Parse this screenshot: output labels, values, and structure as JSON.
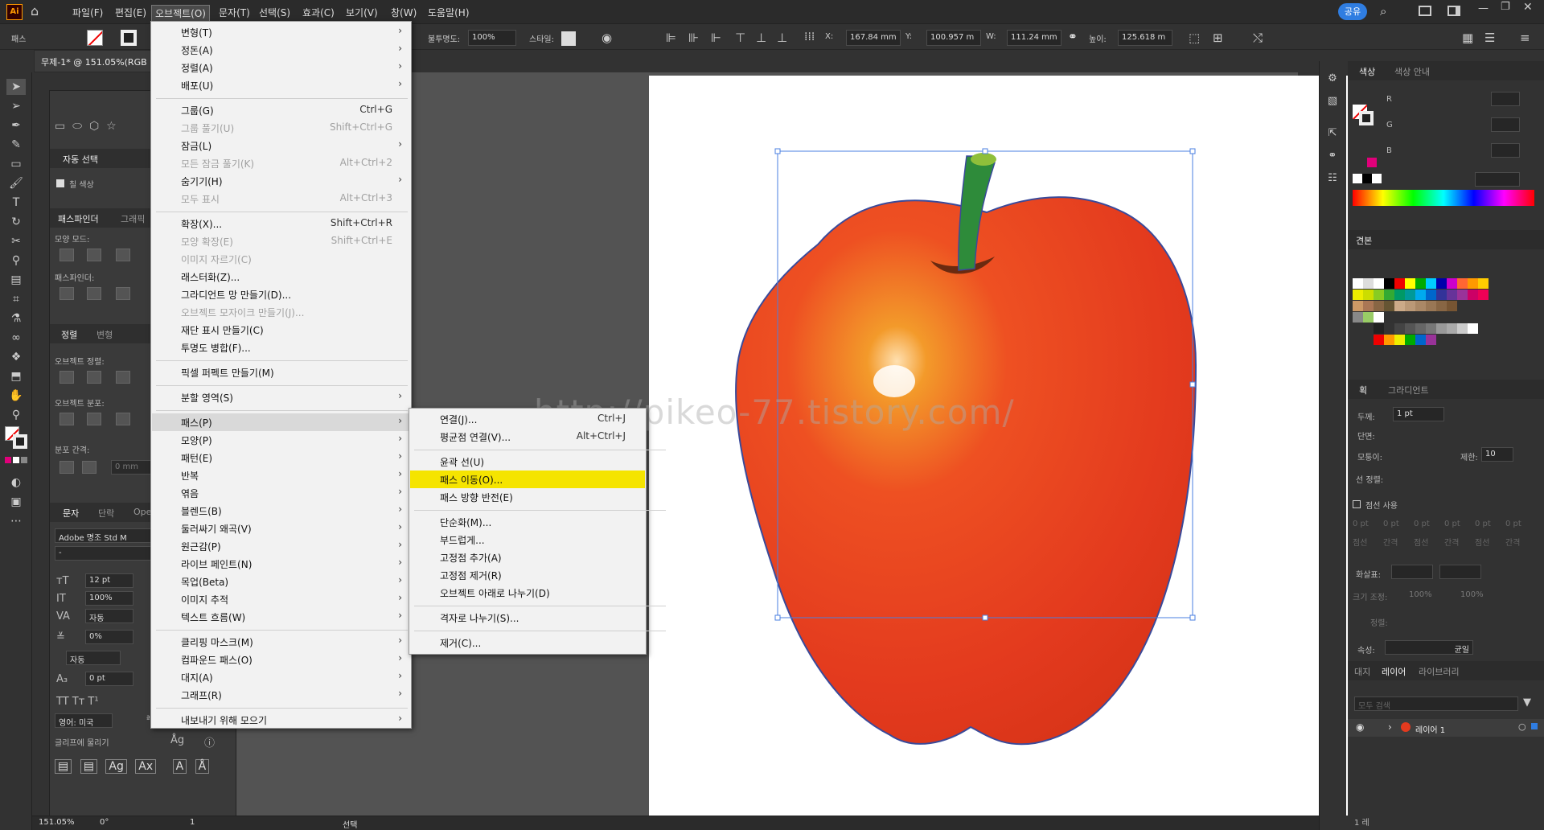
{
  "app": {
    "logo": "Ai"
  },
  "menubar": {
    "items": [
      "파일(F)",
      "편집(E)",
      "오브젝트(O)",
      "문자(T)",
      "선택(S)",
      "효과(C)",
      "보기(V)",
      "창(W)",
      "도움말(H)"
    ],
    "share_label": "공유"
  },
  "control_bar": {
    "mode_label": "패스",
    "opacity_label": "불투명도:",
    "opacity_value": "100%",
    "style_label": "스타일:",
    "x_label": "X:",
    "x_value": "167.84 mm",
    "y_label": "Y:",
    "y_value": "100.957 m",
    "w_label": "W:",
    "w_value": "111.24 mm",
    "h_label": "높이:",
    "h_value": "125.618 m"
  },
  "document": {
    "tab_title": "무제-1* @ 151.05%(RGB"
  },
  "left_panel": {
    "auto_select": "자동 선택",
    "fill_color_chk": "칠 색상",
    "pathfinder_tab": "패스파인더",
    "graphic_tab": "그래픽",
    "shape_mode": "모양 모드:",
    "pathfinder_label": "패스파인더:",
    "align_tab": "정렬",
    "transform_tab": "변형",
    "align_objects": "오브젝트 정렬:",
    "distribute_objects": "오브젝트 분포:",
    "distribute_spacing": "분포 간격:",
    "spacing_value": "0 mm",
    "char_tab": "문자",
    "para_tab": "단락",
    "ope_tab": "Ope",
    "font_name": "Adobe 명조 Std M",
    "font_style": "-",
    "font_size": "12 pt",
    "scale_v": "100%",
    "leading": "자동",
    "tracking": "0%",
    "kerning": "자동",
    "baseline": "0 pt",
    "language": "영어: 미국",
    "aa": "ªa",
    "glyph_snap": "글리프에 물리기"
  },
  "object_menu": {
    "items": [
      {
        "label": "변형(T)",
        "shortcut": "",
        "arrow": true,
        "disabled": false
      },
      {
        "label": "정돈(A)",
        "shortcut": "",
        "arrow": true,
        "disabled": false
      },
      {
        "label": "정렬(A)",
        "shortcut": "",
        "arrow": true,
        "disabled": false
      },
      {
        "label": "배포(U)",
        "shortcut": "",
        "arrow": true,
        "disabled": false
      },
      {
        "sep": true
      },
      {
        "label": "그룹(G)",
        "shortcut": "Ctrl+G",
        "arrow": false,
        "disabled": false
      },
      {
        "label": "그룹 풀기(U)",
        "shortcut": "Shift+Ctrl+G",
        "arrow": false,
        "disabled": true
      },
      {
        "label": "잠금(L)",
        "shortcut": "",
        "arrow": true,
        "disabled": false
      },
      {
        "label": "모든 잠금 풀기(K)",
        "shortcut": "Alt+Ctrl+2",
        "arrow": false,
        "disabled": true
      },
      {
        "label": "숨기기(H)",
        "shortcut": "",
        "arrow": true,
        "disabled": false
      },
      {
        "label": "모두 표시",
        "shortcut": "Alt+Ctrl+3",
        "arrow": false,
        "disabled": true
      },
      {
        "sep": true
      },
      {
        "label": "확장(X)...",
        "shortcut": "Shift+Ctrl+R",
        "arrow": false,
        "disabled": false
      },
      {
        "label": "모양 확장(E)",
        "shortcut": "Shift+Ctrl+E",
        "arrow": false,
        "disabled": true
      },
      {
        "label": "이미지 자르기(C)",
        "shortcut": "",
        "arrow": false,
        "disabled": true
      },
      {
        "label": "래스터화(Z)...",
        "shortcut": "",
        "arrow": false,
        "disabled": false
      },
      {
        "label": "그라디언트 망 만들기(D)...",
        "shortcut": "",
        "arrow": false,
        "disabled": false
      },
      {
        "label": "오브젝트 모자이크 만들기(J)...",
        "shortcut": "",
        "arrow": false,
        "disabled": true
      },
      {
        "label": "재단 표시 만들기(C)",
        "shortcut": "",
        "arrow": false,
        "disabled": false
      },
      {
        "label": "투명도 병합(F)...",
        "shortcut": "",
        "arrow": false,
        "disabled": false
      },
      {
        "sep": true
      },
      {
        "label": "픽셀 퍼펙트 만들기(M)",
        "shortcut": "",
        "arrow": false,
        "disabled": false
      },
      {
        "sep": true
      },
      {
        "label": "분할 영역(S)",
        "shortcut": "",
        "arrow": true,
        "disabled": false
      },
      {
        "sep": true
      },
      {
        "label": "패스(P)",
        "shortcut": "",
        "arrow": true,
        "disabled": false,
        "hl": true
      },
      {
        "label": "모양(P)",
        "shortcut": "",
        "arrow": true,
        "disabled": false
      },
      {
        "label": "패턴(E)",
        "shortcut": "",
        "arrow": true,
        "disabled": false
      },
      {
        "label": "반복",
        "shortcut": "",
        "arrow": true,
        "disabled": false
      },
      {
        "label": "엮음",
        "shortcut": "",
        "arrow": true,
        "disabled": false
      },
      {
        "label": "블렌드(B)",
        "shortcut": "",
        "arrow": true,
        "disabled": false
      },
      {
        "label": "둘러싸기 왜곡(V)",
        "shortcut": "",
        "arrow": true,
        "disabled": false
      },
      {
        "label": "원근감(P)",
        "shortcut": "",
        "arrow": true,
        "disabled": false
      },
      {
        "label": "라이브 페인트(N)",
        "shortcut": "",
        "arrow": true,
        "disabled": false
      },
      {
        "label": "목업(Beta)",
        "shortcut": "",
        "arrow": true,
        "disabled": false
      },
      {
        "label": "이미지 추적",
        "shortcut": "",
        "arrow": true,
        "disabled": false
      },
      {
        "label": "텍스트 흐름(W)",
        "shortcut": "",
        "arrow": true,
        "disabled": false
      },
      {
        "sep": true
      },
      {
        "label": "클리핑 마스크(M)",
        "shortcut": "",
        "arrow": true,
        "disabled": false
      },
      {
        "label": "컴파운드 패스(O)",
        "shortcut": "",
        "arrow": true,
        "disabled": false
      },
      {
        "label": "대지(A)",
        "shortcut": "",
        "arrow": true,
        "disabled": false
      },
      {
        "label": "그래프(R)",
        "shortcut": "",
        "arrow": true,
        "disabled": false
      },
      {
        "sep": true
      },
      {
        "label": "내보내기 위해 모으기",
        "shortcut": "",
        "arrow": true,
        "disabled": false
      }
    ]
  },
  "path_submenu": {
    "items": [
      {
        "label": "연결(J)...",
        "shortcut": "Ctrl+J"
      },
      {
        "label": "평균점 연결(V)...",
        "shortcut": "Alt+Ctrl+J"
      },
      {
        "sep": true
      },
      {
        "label": "윤곽 선(U)",
        "shortcut": ""
      },
      {
        "label": "패스 이동(O)...",
        "shortcut": "",
        "hl": true
      },
      {
        "label": "패스 방향 반전(E)",
        "shortcut": ""
      },
      {
        "sep": true
      },
      {
        "label": "단순화(M)...",
        "shortcut": ""
      },
      {
        "label": "부드럽게...",
        "shortcut": ""
      },
      {
        "label": "고정점 추가(A)",
        "shortcut": ""
      },
      {
        "label": "고정점 제거(R)",
        "shortcut": ""
      },
      {
        "label": "오브젝트 아래로 나누기(D)",
        "shortcut": ""
      },
      {
        "sep": true
      },
      {
        "label": "격자로 나누기(S)...",
        "shortcut": ""
      },
      {
        "sep": true
      },
      {
        "label": "제거(C)...",
        "shortcut": ""
      }
    ]
  },
  "watermark": "http://pikeo-77.tistory.com/",
  "right_panel": {
    "color_tab": "색상",
    "color_guide_tab": "색상 안내",
    "r_label": "R",
    "g_label": "G",
    "b_label": "B",
    "swatches_tab": "견본",
    "stroke_tab": "획",
    "gradient_tab": "그라디언트",
    "weight_label": "두께:",
    "weight_value": "1 pt",
    "cap_label": "단면:",
    "corner_label": "모퉁이:",
    "limit_label": "제한:",
    "limit_value": "10",
    "align_stroke_label": "선 정렬:",
    "dashed_label": "점선 사용",
    "dash_fields": [
      "0 pt",
      "0 pt",
      "0 pt",
      "0 pt",
      "0 pt",
      "0 pt"
    ],
    "dash_labels": [
      "점선",
      "간격",
      "점선",
      "간격",
      "점선",
      "간격"
    ],
    "arrow_label": "화살표:",
    "scale_label": "크기 조정:",
    "scale_vals": [
      "100%",
      "100%"
    ],
    "align_label": "정렬:",
    "profile_label": "속성:",
    "profile_value": "균일",
    "artboard_tab": "대지",
    "layers_tab": "레이어",
    "library_tab": "라이브러리",
    "layer_search": "모두 검색",
    "layer_name": "레이어 1",
    "layer_count": "1 레"
  },
  "status_bar": {
    "zoom": "151.05%",
    "rotate": "0°",
    "artboard": "1",
    "mode": "선택"
  },
  "colors": {
    "accent": "#2f7de1",
    "highlight": "#f5e400",
    "apple_red": "#e5391f",
    "stem_green": "#2e8b3a",
    "magenta": "#e0007a"
  }
}
